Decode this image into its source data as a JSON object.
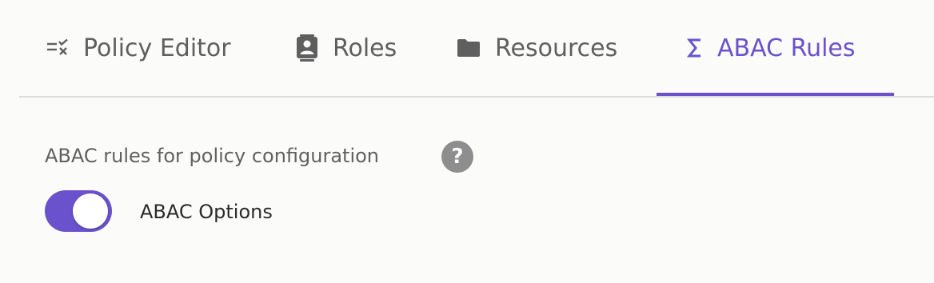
{
  "tabs": [
    {
      "label": "Policy Editor",
      "icon": "list-check-icon",
      "active": false
    },
    {
      "label": "Roles",
      "icon": "contact-card-icon",
      "active": false
    },
    {
      "label": "Resources",
      "icon": "folder-icon",
      "active": false
    },
    {
      "label": "ABAC Rules",
      "icon": "sigma-icon",
      "active": true
    }
  ],
  "section": {
    "title": "ABAC rules for policy configuration",
    "help_glyph": "?"
  },
  "abac_toggle": {
    "label": "ABAC Options",
    "checked": true
  },
  "colors": {
    "accent": "#6a52cc",
    "tab_text": "#5f5f5f",
    "help_icon_bg": "#8e8e8e",
    "background": "#fbfbfa"
  }
}
